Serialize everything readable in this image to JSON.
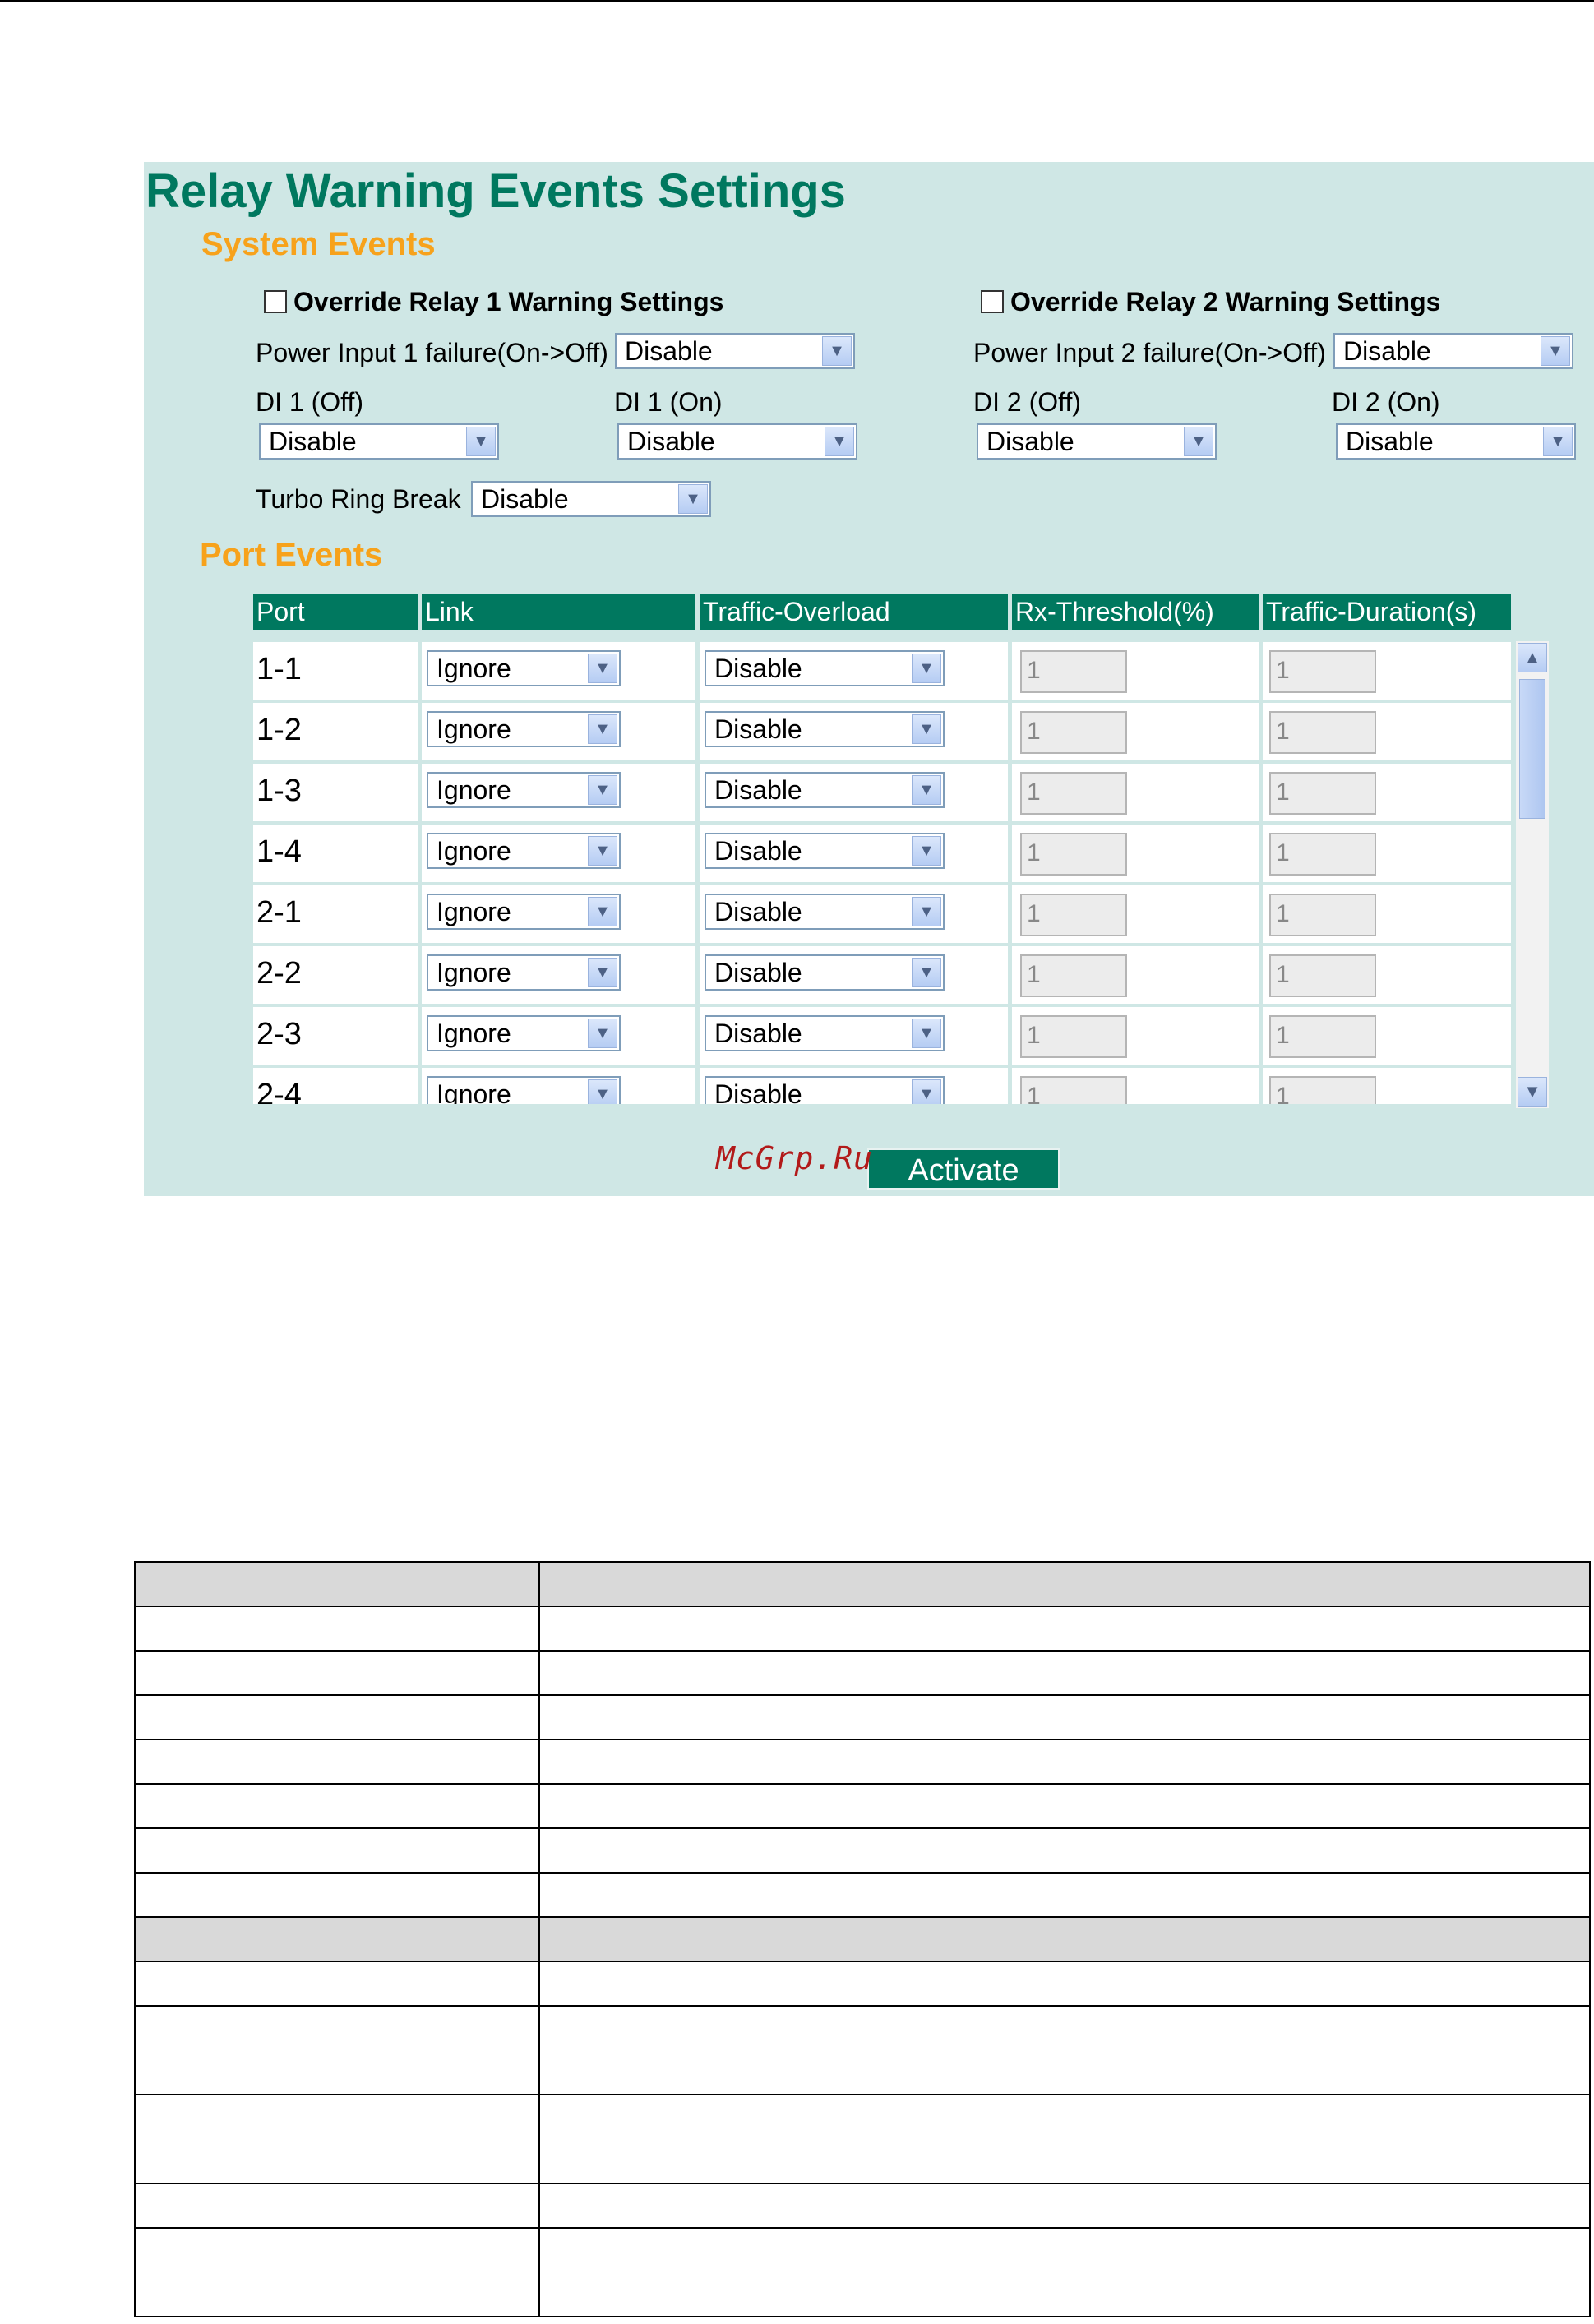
{
  "panel": {
    "title": "Relay Warning Events Settings",
    "system_events": {
      "heading": "System Events",
      "override1": {
        "label": "Override Relay 1 Warning Settings",
        "checked": false
      },
      "override2": {
        "label": "Override Relay 2 Warning Settings",
        "checked": false
      },
      "power_input1": {
        "label": "Power Input 1 failure(On->Off)",
        "value": "Disable"
      },
      "power_input2": {
        "label": "Power Input 2 failure(On->Off)",
        "value": "Disable"
      },
      "di1_off": {
        "label": "DI 1 (Off)",
        "value": "Disable"
      },
      "di1_on": {
        "label": "DI 1 (On)",
        "value": "Disable"
      },
      "di2_off": {
        "label": "DI 2 (Off)",
        "value": "Disable"
      },
      "di2_on": {
        "label": "DI 2 (On)",
        "value": "Disable"
      },
      "turbo_ring_break": {
        "label": "Turbo Ring Break",
        "value": "Disable"
      }
    },
    "port_events": {
      "heading": "Port Events",
      "columns": [
        "Port",
        "Link",
        "Traffic-Overload",
        "Rx-Threshold(%)",
        "Traffic-Duration(s)"
      ],
      "rows": [
        {
          "port": "1-1",
          "link": "Ignore",
          "traffic_overload": "Disable",
          "rx_threshold": "1",
          "traffic_duration": "1"
        },
        {
          "port": "1-2",
          "link": "Ignore",
          "traffic_overload": "Disable",
          "rx_threshold": "1",
          "traffic_duration": "1"
        },
        {
          "port": "1-3",
          "link": "Ignore",
          "traffic_overload": "Disable",
          "rx_threshold": "1",
          "traffic_duration": "1"
        },
        {
          "port": "1-4",
          "link": "Ignore",
          "traffic_overload": "Disable",
          "rx_threshold": "1",
          "traffic_duration": "1"
        },
        {
          "port": "2-1",
          "link": "Ignore",
          "traffic_overload": "Disable",
          "rx_threshold": "1",
          "traffic_duration": "1"
        },
        {
          "port": "2-2",
          "link": "Ignore",
          "traffic_overload": "Disable",
          "rx_threshold": "1",
          "traffic_duration": "1"
        },
        {
          "port": "2-3",
          "link": "Ignore",
          "traffic_overload": "Disable",
          "rx_threshold": "1",
          "traffic_duration": "1"
        },
        {
          "port": "2-4",
          "link": "Ignore",
          "traffic_overload": "Disable",
          "rx_threshold": "1",
          "traffic_duration": "1"
        }
      ]
    },
    "activate_label": "Activate"
  },
  "watermark": "McGrp.Ru",
  "icons": {
    "dropdown": "chevron-down-icon",
    "scroll_up": "arrow-up-icon",
    "scroll_down": "arrow-down-icon"
  },
  "colors": {
    "panel_bg": "#cfe7e5",
    "title": "#00785f",
    "section": "#f7a21b",
    "header_bg": "#00785f"
  }
}
